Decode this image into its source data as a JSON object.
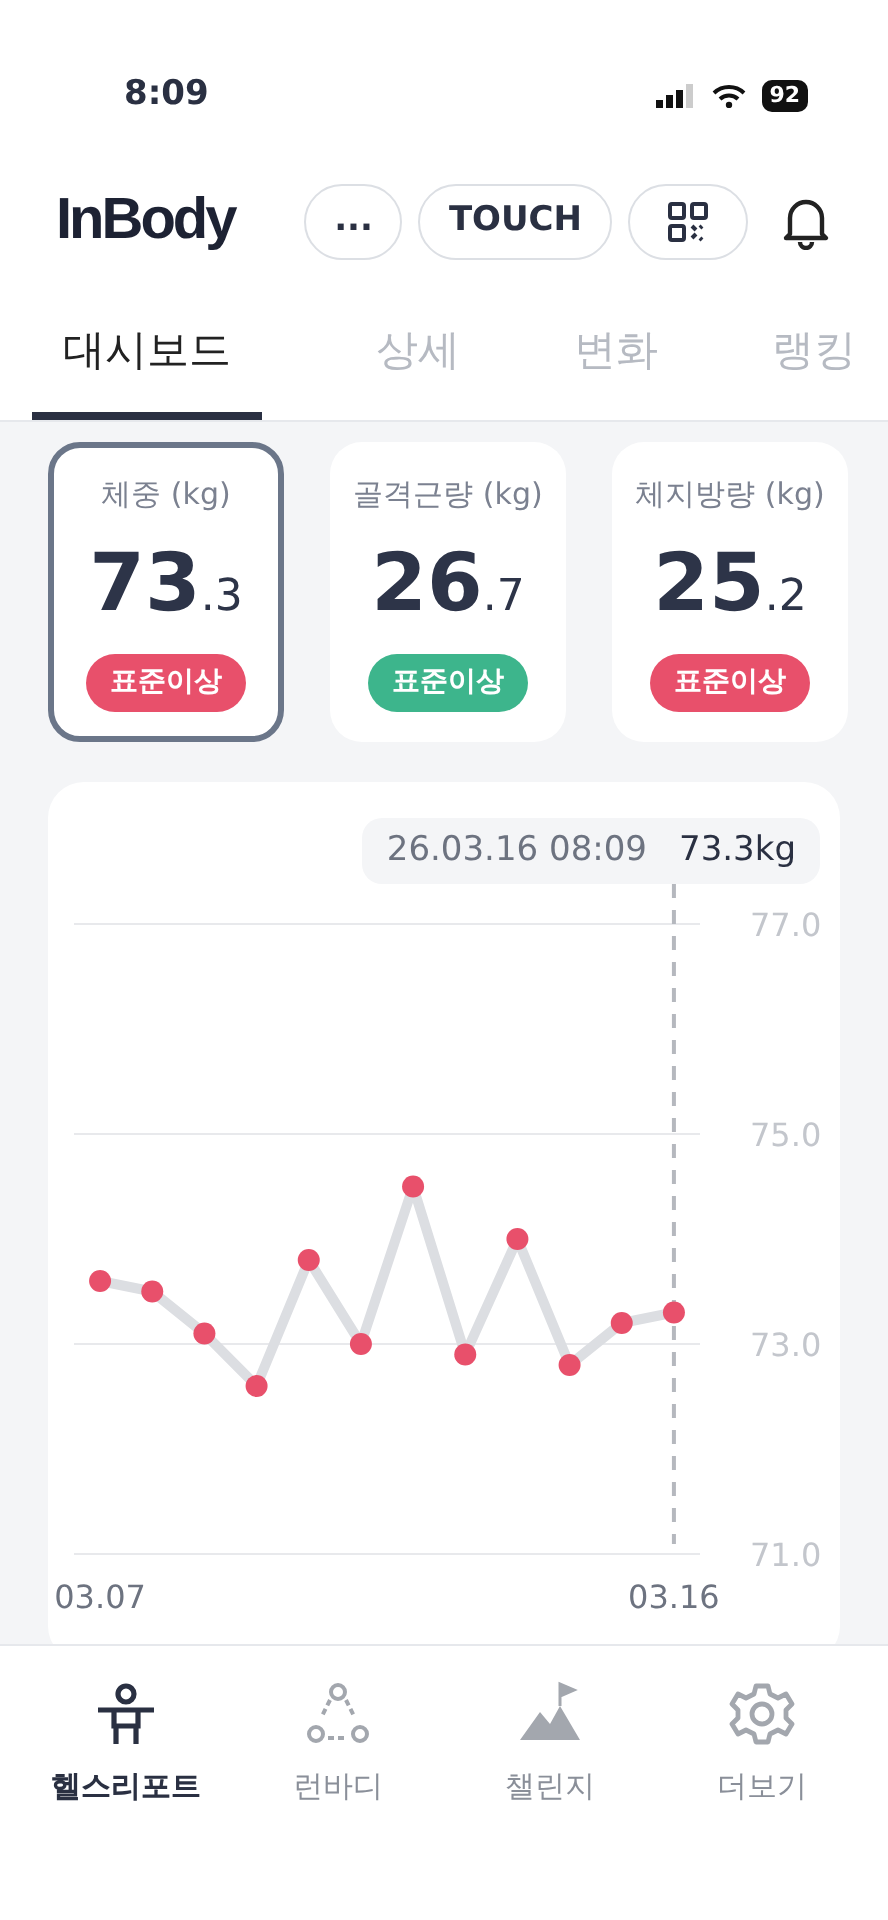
{
  "status_bar": {
    "time": "8:09",
    "battery": "92"
  },
  "header": {
    "logo": "InBody",
    "buttons": [
      {
        "kind": "text",
        "label": "..."
      },
      {
        "kind": "text",
        "label": "TOUCH"
      },
      {
        "kind": "qr"
      }
    ]
  },
  "tabs": [
    {
      "label": "대시보드",
      "selected": true
    },
    {
      "label": "상세",
      "selected": false
    },
    {
      "label": "변화",
      "selected": false
    },
    {
      "label": "랭킹",
      "selected": false
    }
  ],
  "metrics": [
    {
      "label": "체중 (kg)",
      "value_main": "73",
      "value_decimal": ".3",
      "badge": "표준이상",
      "color": "#e8506b",
      "selected": true
    },
    {
      "label": "골격근량 (kg)",
      "value_main": "26",
      "value_decimal": ".7",
      "badge": "표준이상",
      "color": "#3db58c",
      "selected": false
    },
    {
      "label": "체지방량 (kg)",
      "value_main": "25",
      "value_decimal": ".2",
      "badge": "표준이상",
      "color": "#e8506b",
      "selected": false
    }
  ],
  "chart": {
    "tooltip": {
      "date": "26.03.16 08:09",
      "value": "73.3kg"
    },
    "chart_data": {
      "type": "line",
      "categories": [
        "03.07",
        null,
        null,
        null,
        null,
        null,
        null,
        null,
        null,
        null,
        null,
        "03.16"
      ],
      "ylim": [
        71,
        77
      ],
      "yticks": [
        {
          "value": 77,
          "label": "77.0"
        },
        {
          "value": 75,
          "label": "75.0"
        },
        {
          "value": 73,
          "label": "73.0"
        },
        {
          "value": 71,
          "label": "71.0"
        }
      ],
      "series": [
        {
          "type": "line",
          "color": "#dcdee2",
          "values": [
            73.6,
            73.5,
            73.1,
            72.6,
            73.8,
            73.0,
            74.5,
            72.9,
            74.0,
            72.8,
            73.2,
            73.3
          ]
        },
        {
          "type": "scatter",
          "color": "#e8506b",
          "values": [
            73.6,
            73.5,
            73.1,
            72.6,
            73.8,
            73.0,
            74.5,
            72.9,
            74.0,
            72.8,
            73.2,
            73.3
          ]
        }
      ]
    }
  },
  "bottom_nav": [
    {
      "kind": "report",
      "label": "헬스리포트",
      "selected": true
    },
    {
      "kind": "runbody",
      "label": "런바디",
      "selected": false
    },
    {
      "kind": "challenge",
      "label": "챌린지",
      "selected": false
    },
    {
      "kind": "more",
      "label": "더보기",
      "selected": false
    }
  ]
}
